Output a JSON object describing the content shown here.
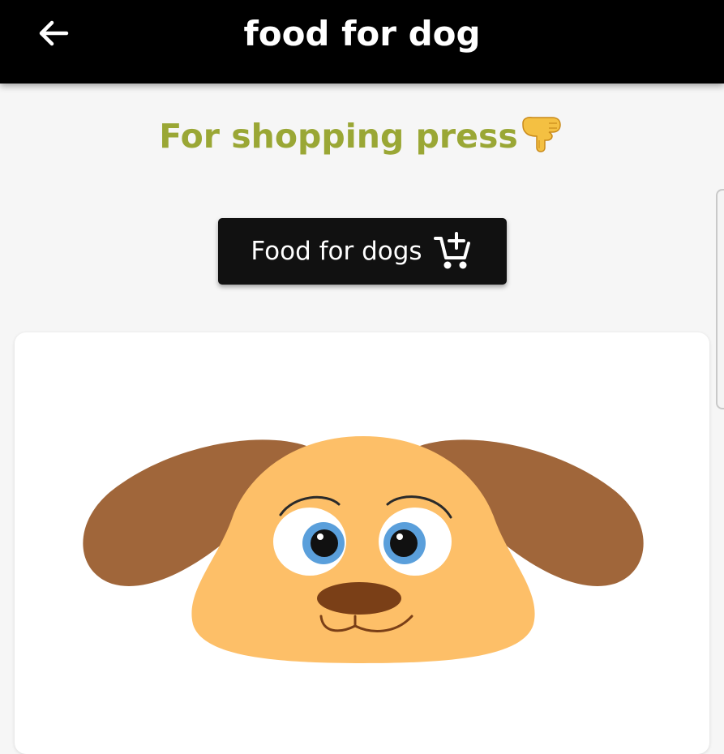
{
  "app_bar": {
    "title": "food for dog",
    "back_icon": "arrow-left-icon"
  },
  "prompt": {
    "text": "For shopping press",
    "emoji": "pointing-down-hand-icon",
    "color": "#9aa735"
  },
  "shop_button": {
    "label": "Food for dogs",
    "icon": "add-to-cart-icon"
  },
  "card": {
    "image": "dog-face-illustration"
  },
  "colors": {
    "app_bar_bg": "#000000",
    "page_bg": "#f6f6f6",
    "button_bg": "#111111",
    "dog_face": "#fdbf68",
    "dog_ears": "#a0663a",
    "dog_nose": "#7a3f17",
    "dog_eyes": "#5a9fdb"
  }
}
